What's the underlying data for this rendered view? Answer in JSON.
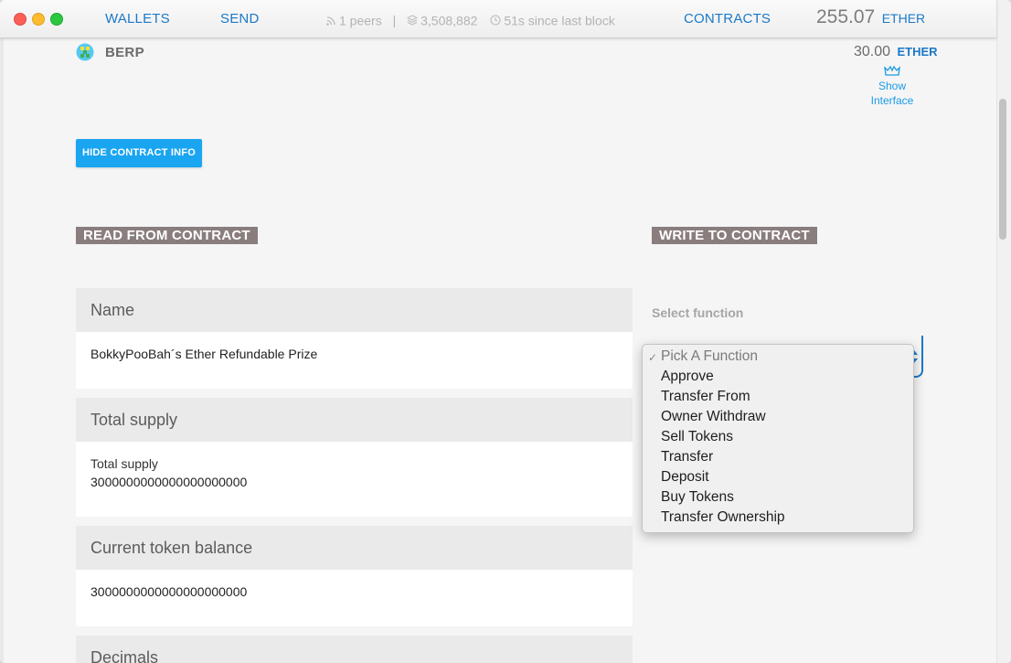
{
  "nav": {
    "wallets": "WALLETS",
    "send": "SEND",
    "contracts": "CONTRACTS"
  },
  "status": {
    "peers": "1 peers",
    "block": "3,508,882",
    "since": "51s since last block"
  },
  "account_balance": {
    "amount": "255.07",
    "unit": "ETHER"
  },
  "contract": {
    "name": "BERP",
    "balance_amount": "30.00",
    "balance_unit": "ETHER",
    "show_interface": "Show Interface",
    "hide_info_button": "HIDE CONTRACT INFO"
  },
  "read_section": {
    "title": "READ FROM CONTRACT",
    "cards": [
      {
        "label": "Name",
        "lines": [
          "BokkyPooBah´s Ether Refundable Prize"
        ]
      },
      {
        "label": "Total supply",
        "lines": [
          "Total supply",
          "3000000000000000000000"
        ]
      },
      {
        "label": "Current token balance",
        "lines": [
          "3000000000000000000000"
        ]
      },
      {
        "label": "Decimals",
        "lines": []
      }
    ]
  },
  "write_section": {
    "title": "WRITE TO CONTRACT",
    "select_label": "Select function",
    "selected": "Pick A Function",
    "options": [
      "Pick A Function",
      "Approve",
      "Transfer From",
      "Owner Withdraw",
      "Sell Tokens",
      "Transfer",
      "Deposit",
      "Buy Tokens",
      "Transfer Ownership"
    ]
  },
  "colors": {
    "accent": "#1a79c9",
    "button": "#1aa5f0",
    "section_header": "#8a7d7d",
    "card_header": "#ebeaea"
  }
}
